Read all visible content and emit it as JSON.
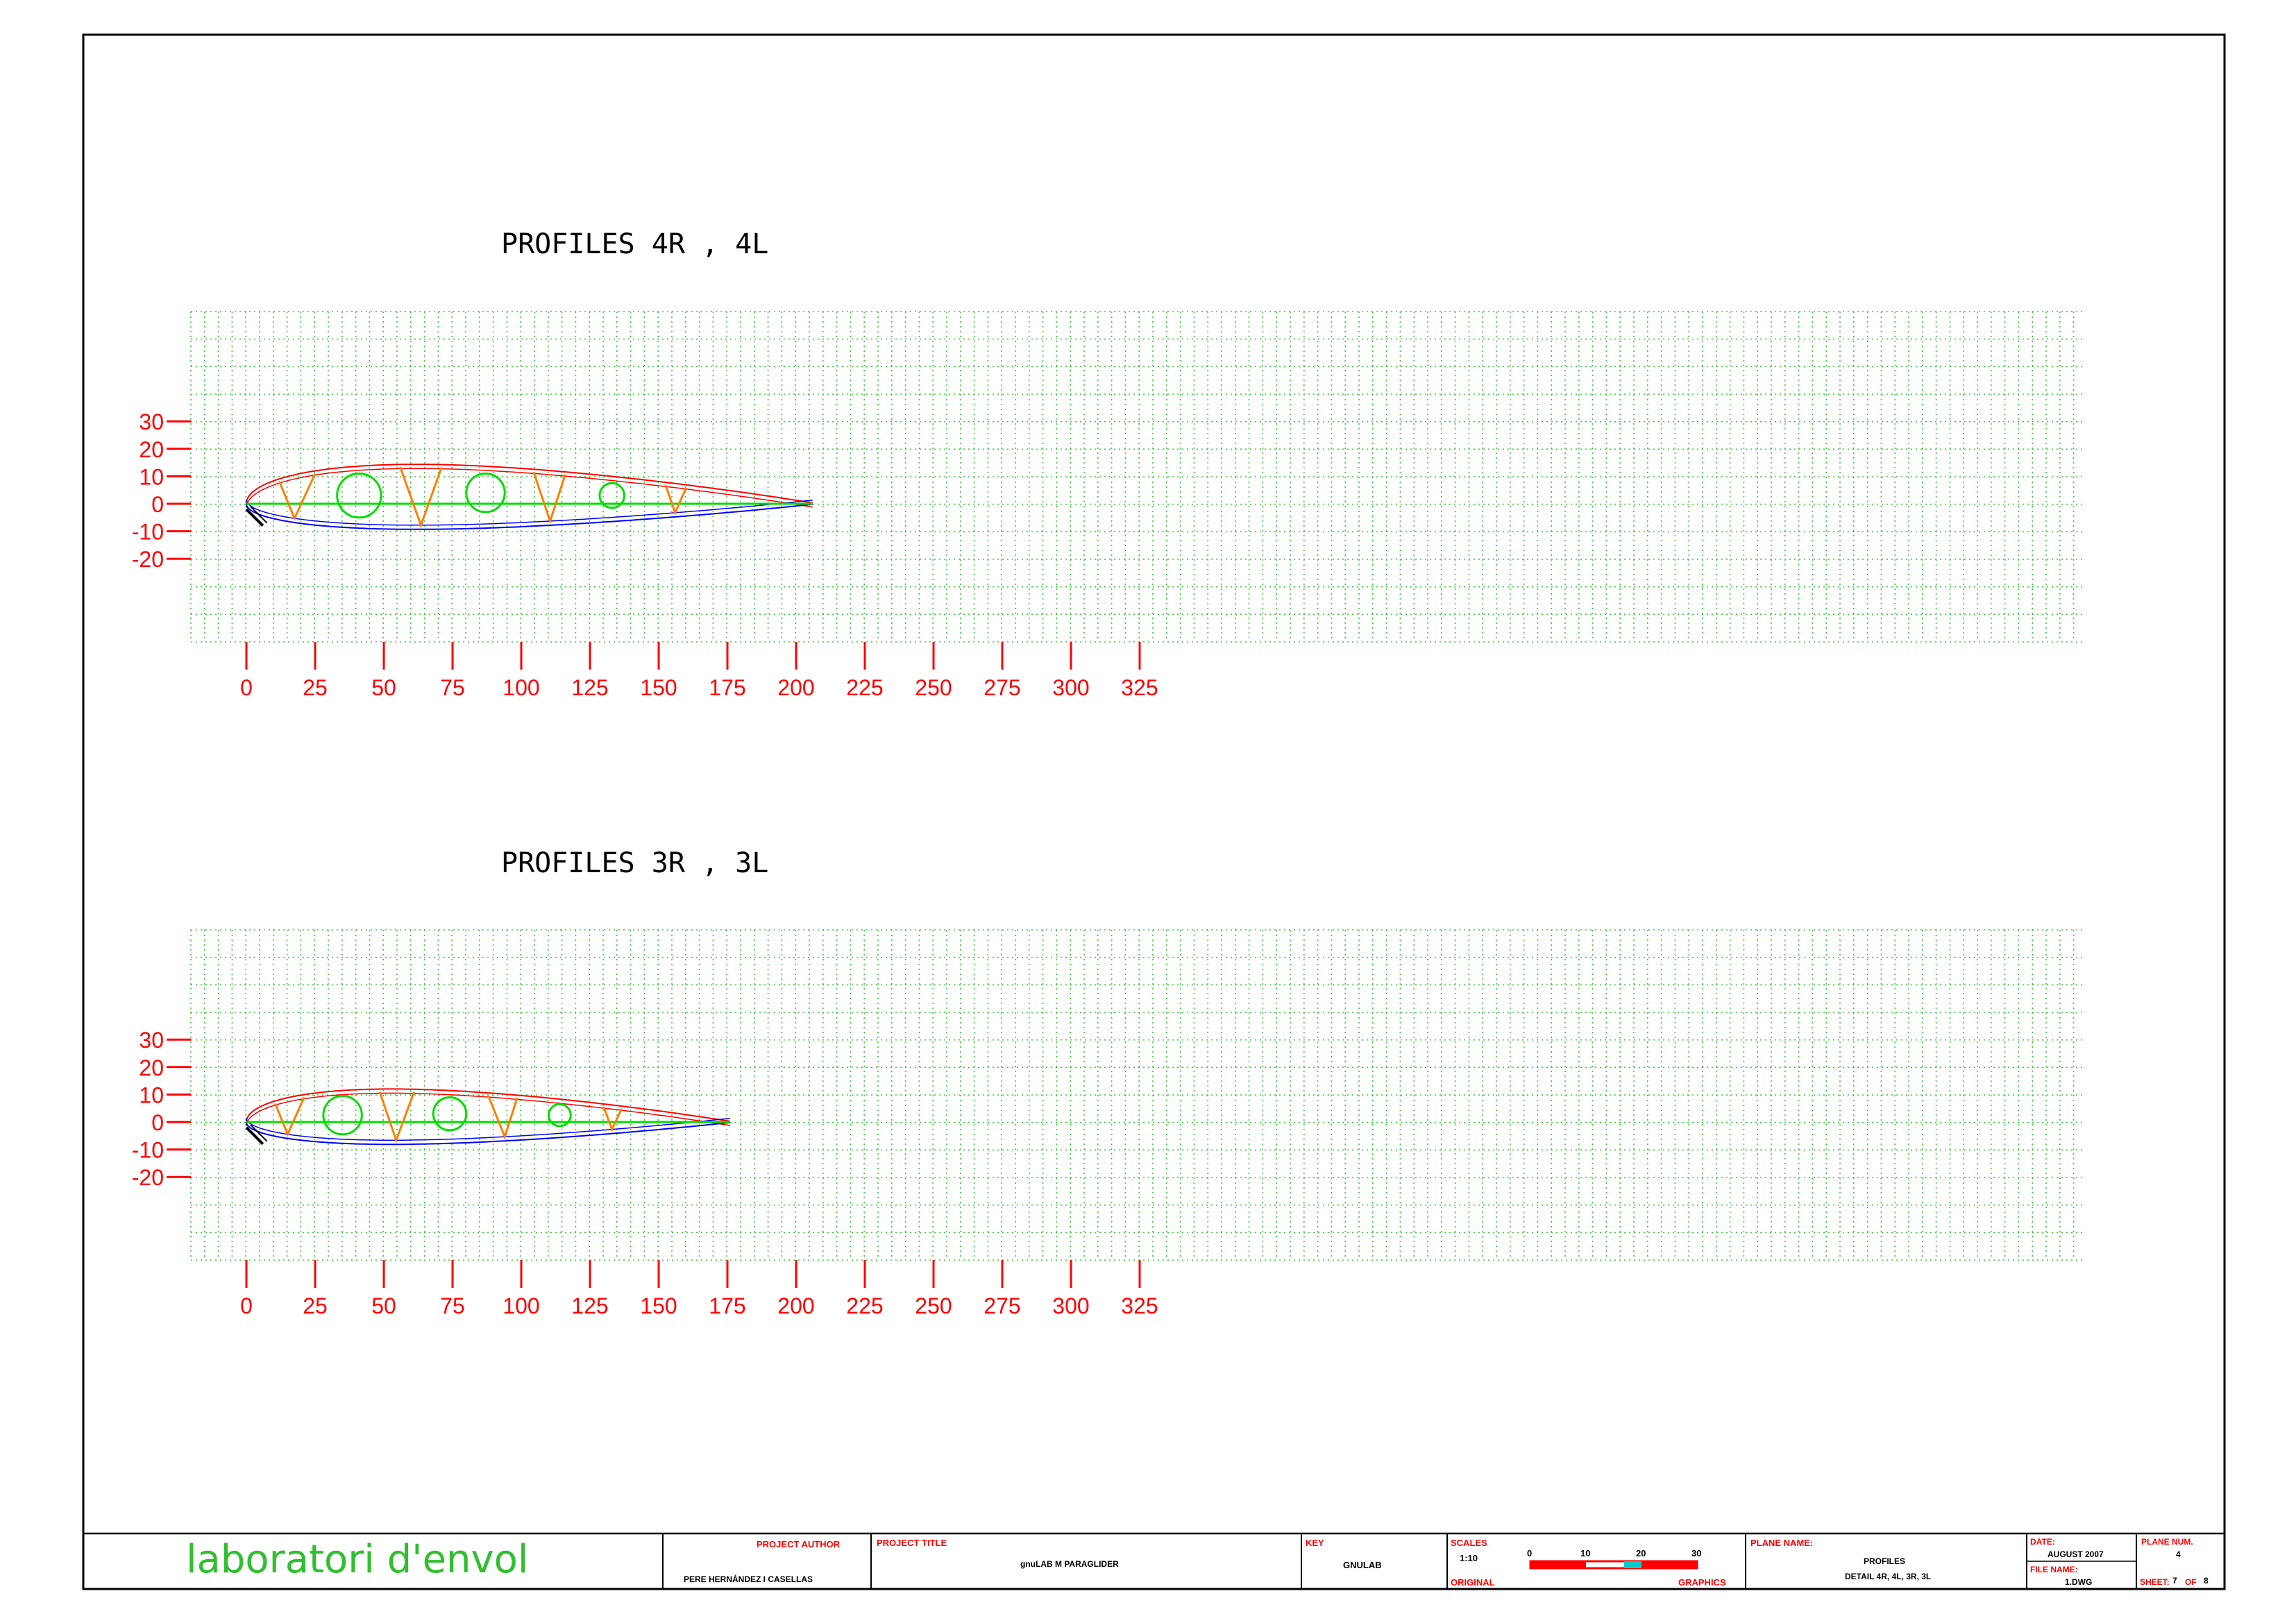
{
  "drawing": {
    "panels": [
      {
        "title": "PROFILES 4R , 4L",
        "x_ticks": [
          "0",
          "25",
          "50",
          "75",
          "100",
          "125",
          "150",
          "175",
          "200",
          "225",
          "250",
          "275",
          "300",
          "325"
        ],
        "y_ticks": [
          "30",
          "20",
          "10",
          "0",
          "-10",
          "-20"
        ],
        "chord_length": 206,
        "upper_max": 18.5,
        "lower_max": 12,
        "circles": [
          {
            "cx": 41,
            "cy": 3,
            "r": 8
          },
          {
            "cx": 87,
            "cy": 4,
            "r": 7
          },
          {
            "cx": 133,
            "cy": 3,
            "r": 4.5
          }
        ],
        "ribs": [
          [
            12,
            17.5,
            25
          ],
          [
            56,
            63.5,
            71
          ],
          [
            104.5,
            110.5,
            116
          ],
          [
            152.5,
            156,
            160
          ]
        ]
      },
      {
        "title": "PROFILES 3R , 3L",
        "x_ticks": [
          "0",
          "25",
          "50",
          "75",
          "100",
          "125",
          "150",
          "175",
          "200",
          "225",
          "250",
          "275",
          "300",
          "325"
        ],
        "y_ticks": [
          "30",
          "20",
          "10",
          "0",
          "-10",
          "-20"
        ],
        "chord_length": 176,
        "upper_max": 15.5,
        "lower_max": 10.5,
        "circles": [
          {
            "cx": 35,
            "cy": 2.5,
            "r": 7
          },
          {
            "cx": 74,
            "cy": 3,
            "r": 6
          },
          {
            "cx": 114,
            "cy": 2.5,
            "r": 4
          }
        ],
        "ribs": [
          [
            10.5,
            15,
            21
          ],
          [
            48.5,
            54.5,
            61
          ],
          [
            88,
            94,
            98.5
          ],
          [
            130,
            133,
            136.5
          ]
        ]
      }
    ]
  },
  "title_block": {
    "logo": "laboratori d'envol",
    "author_label": "PROJECT AUTHOR",
    "author_value": "PERE HERNÁNDEZ I CASELLAS",
    "project_label": "PROJECT TITLE",
    "project_value": "gnuLAB M PARAGLIDER",
    "key_label": "KEY",
    "key_value": "GNULAB",
    "scales_label": "SCALES",
    "scale_value": "1:10",
    "scale_ticks": [
      "0",
      "10",
      "20",
      "30"
    ],
    "original_label": "ORIGINAL",
    "graphics_label": "GRAPHICS",
    "plane_name_label": "PLANE NAME:",
    "plane_name_line1": "PROFILES",
    "plane_name_line2": "DETAIL 4R, 4L, 3R, 3L",
    "date_label": "DATE:",
    "date_value": "AUGUST 2007",
    "file_label": "FILE NAME:",
    "file_value": "1.DWG",
    "plane_num_label": "PLANE NUM.",
    "plane_num_value": "4",
    "sheet_label": "SHEET:",
    "sheet_value": "7",
    "of_label": "OF",
    "of_value": "8"
  },
  "colors": {
    "grid": "#33cc33",
    "axis": "#ff0000",
    "upper_surface": "#ff0000",
    "lower_surface": "#0000ff",
    "ribs": "#ff7f00",
    "holes": "#00dd00",
    "chord": "#00dd00"
  }
}
